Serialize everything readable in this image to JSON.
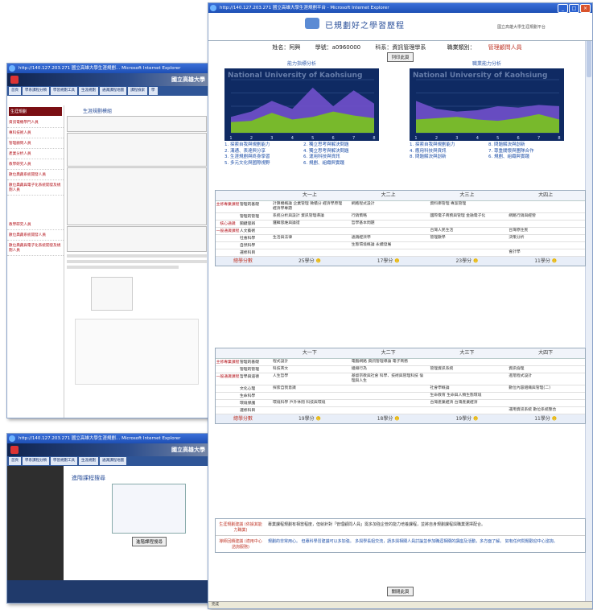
{
  "back_window_1": {
    "title": "http://140.127.203.271 國立高雄大學生涯規劃… Microsoft Internet Explorer",
    "banner": "國立高雄大學",
    "nav": [
      "首頁",
      "學系課程分類",
      "學習規劃工具",
      "生涯規劃",
      "通識課程地圖",
      "課程檢索",
      "學"
    ],
    "side_head": "生涯規劃",
    "side_items": [
      "資訊電機學門人員",
      "專科技術人員",
      "管理顧問人員",
      "產業分析人員",
      "教學研究人員",
      "數位典藏系統開發人員",
      "數位典藏與電子化系統開發及規劃人員",
      "教學研究人員",
      "數位典藏系統開發人員",
      "數位典藏與電子化系統開發及規劃人員"
    ],
    "section_title": "生涯規劃模組"
  },
  "back_window_2": {
    "title": "http://140.127.203.271 國立高雄大學生涯規劃… Microsoft Internet Explorer",
    "banner": "國立高雄大學",
    "search_title": "進階課程搜尋",
    "button": "進階課程搜尋"
  },
  "front_window": {
    "title": "http://140.127.203.271 國立高雄大學生涯規劃平台 - Microsoft Internet Explorer",
    "header_title": "已規劃好之學習歷程",
    "header_right": "國立高雄大學生涯規劃平台",
    "info": {
      "name": "姓名：阿興",
      "id": "學號：a0960000",
      "dept": "科系：資訊管理學系",
      "role_label": "職業類別：",
      "role": "管理顧問人員"
    },
    "print_button": "列印此頁",
    "chart_titles": [
      "能力指標分析",
      "職業能力分析"
    ],
    "chart_watermark": "National University of Kaohsiung",
    "legend": [
      "1. 探索自我與規劃能力",
      "2. 溝通、表達與分享",
      "3. 生涯規劃與終身學習",
      "4. 應用科技與資訊",
      "5. 多元文化與國際視野",
      "6. 規劃、組織與實踐",
      "7. 尊重關懷與團隊合作",
      "8. 問題解決與創新"
    ],
    "legend_b": [
      "2. 獨立思考與解決問題",
      "4. 獨立思考與解決問題",
      "6. 運用科技與資訊",
      "8. 問題解決與創新"
    ],
    "colors": {
      "purple": "#6f4fc9",
      "green": "#79c21f",
      "grid": "#1a3a7a"
    },
    "semester_headers_top": [
      "大一上",
      "大二上",
      "大三上",
      "大四上"
    ],
    "semester_headers_bottom": [
      "大一下",
      "大二下",
      "大三下",
      "大四下"
    ],
    "rows_top": [
      {
        "cat": "主修專業課程",
        "sub": "管理的基礎",
        "cells": [
          "計算機概論 企業管理 微積分 經濟學原理 經濟學專題",
          "網路程式設計",
          "資料庫管理 專案管理",
          ""
        ]
      },
      {
        "cat": "",
        "sub": "管理的管理",
        "cells": [
          "系統分析與設計 資訊管理導論",
          "行銷策略",
          "國際電子商務與管理 金融電子化",
          "網路行銷與經營"
        ]
      },
      {
        "cat": "核心通識",
        "sub": "關鍵思辨",
        "cells": [
          "邏輯思維與論證",
          "哲學基本問題",
          "",
          ""
        ]
      },
      {
        "cat": "一般通識課程",
        "sub": "人文藝術",
        "cells": [
          "",
          "",
          "台灣人民生活",
          "台灣原住民"
        ]
      },
      {
        "cat": "",
        "sub": "社會科學",
        "cells": [
          "生活與法律",
          "通識經濟學",
          "管理數學",
          "決策分析"
        ]
      },
      {
        "cat": "",
        "sub": "自然科學",
        "cells": [
          "",
          "生態環境概論 永續發展",
          "",
          ""
        ]
      },
      {
        "cat": "",
        "sub": "選修科目",
        "cells": [
          "",
          "",
          "",
          "會計學"
        ]
      }
    ],
    "totals_top": [
      "25學分",
      "17學分",
      "23學分",
      "11學分"
    ],
    "rows_bottom": [
      {
        "cat": "主修專業課程",
        "sub": "管理的基礎",
        "cells": [
          "程式設計",
          "電腦網路 資訊管理導論 電子商務",
          "",
          ""
        ]
      },
      {
        "cat": "",
        "sub": "管理的管理",
        "cells": [
          "科技英文",
          "組織行為",
          "管理資訊系統",
          "資訊倫理"
        ]
      },
      {
        "cat": "一般通識課程",
        "sub": "哲學與道德",
        "cells": [
          "人生哲學",
          "基督宗教與社會 科學、技術與管理科技 倫理與人生",
          "",
          "進階程式設計"
        ]
      },
      {
        "cat": "",
        "sub": "文化心理",
        "cells": [
          "探索自我意識",
          "",
          "社會學概論",
          "數位內容組織與管理(二)"
        ]
      },
      {
        "cat": "",
        "sub": "生命科學",
        "cells": [
          "",
          "",
          "生命教育 生命與人類生態環境",
          ""
        ]
      },
      {
        "cat": "",
        "sub": "環境保護",
        "cells": [
          "環境科學 戶外休閒 科技與環境",
          "",
          "台灣產業經濟 台灣產業經濟",
          ""
        ]
      },
      {
        "cat": "",
        "sub": "選修科目",
        "cells": [
          "",
          "",
          "",
          "運用資訊系統 數位系統整合"
        ]
      }
    ],
    "totals_bottom": [
      "19學分",
      "18學分",
      "19學分",
      "11學分"
    ],
    "total_label": "總學分數",
    "advice": [
      {
        "label": "生涯規劃建議 (依據其能力職業)",
        "text": "專業課程規劃有相當程度，但就針對「管理顧問人員」需多加強企管的能力培養課程，並將自身規劃課程與職業選擇配合。"
      },
      {
        "label": "導師回饋建議 (適用中心諮詢服務)",
        "text": "規劃的非常用心。 但專科學習建議可以多加強。 多與學長姐交流，請多與相關人員討論並參加職涯相關的講座及活動，多方面了解。 如有任何問題歡迎中心諮詢。"
      }
    ],
    "close_button": "關閉此頁",
    "status": "完成"
  },
  "chart_data": [
    {
      "type": "area",
      "title": "能力指標分析",
      "x": [
        1,
        2,
        3,
        4,
        5,
        6,
        7,
        8
      ],
      "ylim": [
        0,
        4
      ],
      "series": [
        {
          "name": "",
          "values": [
            1.2,
            1.6,
            2.4,
            1.8,
            3.4,
            2.0,
            3.2,
            2.2
          ]
        },
        {
          "name": "",
          "values": [
            0.8,
            0.9,
            1.5,
            1.0,
            1.2,
            1.6,
            1.3,
            1.1
          ]
        }
      ]
    },
    {
      "type": "area",
      "title": "職業能力分析",
      "x": [
        1,
        2,
        3,
        4,
        5,
        6,
        7,
        8
      ],
      "ylim": [
        0,
        4
      ],
      "series": [
        {
          "name": "",
          "values": [
            2.4,
            1.8,
            1.6,
            1.7,
            2.0,
            1.9,
            2.1,
            2.0
          ]
        },
        {
          "name": "",
          "values": [
            1.0,
            1.1,
            1.2,
            1.0,
            0.9,
            1.1,
            1.4,
            1.0
          ]
        }
      ]
    }
  ]
}
